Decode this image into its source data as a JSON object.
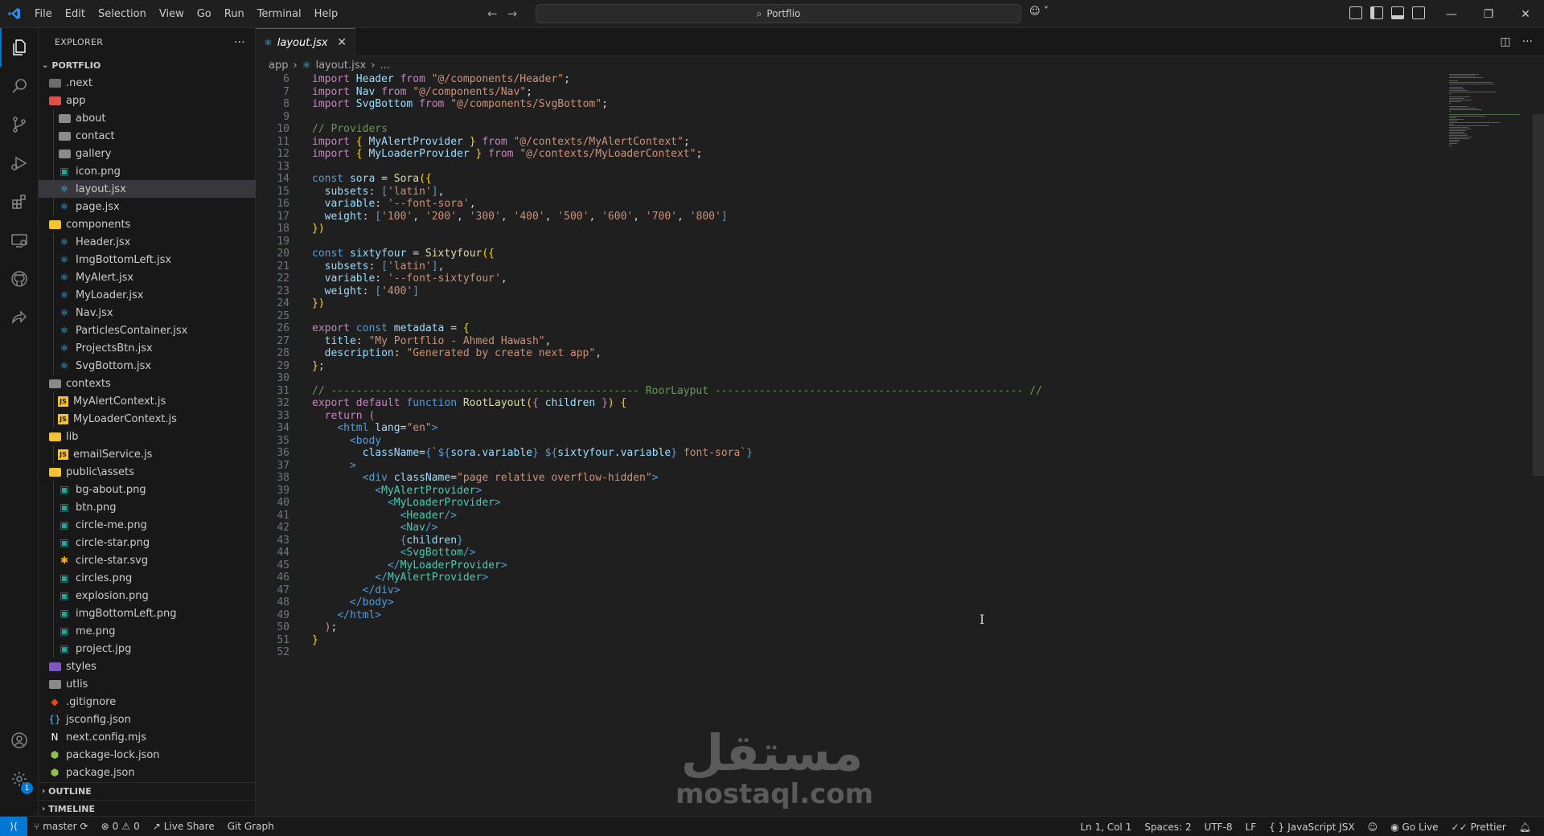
{
  "titlebar": {
    "menu": [
      "File",
      "Edit",
      "Selection",
      "View",
      "Go",
      "Run",
      "Terminal",
      "Help"
    ],
    "search_text": "Portflio"
  },
  "sidebar": {
    "title": "EXPLORER",
    "root": "PORTFLIO",
    "items": [
      {
        "name": ".next",
        "depth": 0,
        "kind": "folder",
        "color": "#6c6c6c"
      },
      {
        "name": "app",
        "depth": 0,
        "kind": "folder",
        "color": "#e04e4e",
        "open": true
      },
      {
        "name": "about",
        "depth": 1,
        "kind": "folder",
        "color": "#8a8a8a"
      },
      {
        "name": "contact",
        "depth": 1,
        "kind": "folder",
        "color": "#8a8a8a"
      },
      {
        "name": "gallery",
        "depth": 1,
        "kind": "folder",
        "color": "#8a8a8a"
      },
      {
        "name": "icon.png",
        "depth": 1,
        "kind": "image",
        "color": "#26a69a"
      },
      {
        "name": "layout.jsx",
        "depth": 1,
        "kind": "react",
        "color": "#4fc3f7",
        "selected": true
      },
      {
        "name": "page.jsx",
        "depth": 1,
        "kind": "react",
        "color": "#4fc3f7"
      },
      {
        "name": "components",
        "depth": 0,
        "kind": "folder",
        "color": "#f4c430",
        "open": true
      },
      {
        "name": "Header.jsx",
        "depth": 1,
        "kind": "react",
        "color": "#4fc3f7"
      },
      {
        "name": "ImgBottomLeft.jsx",
        "depth": 1,
        "kind": "react",
        "color": "#4fc3f7"
      },
      {
        "name": "MyAlert.jsx",
        "depth": 1,
        "kind": "react",
        "color": "#4fc3f7"
      },
      {
        "name": "MyLoader.jsx",
        "depth": 1,
        "kind": "react",
        "color": "#4fc3f7"
      },
      {
        "name": "Nav.jsx",
        "depth": 1,
        "kind": "react",
        "color": "#4fc3f7"
      },
      {
        "name": "ParticlesContainer.jsx",
        "depth": 1,
        "kind": "react",
        "color": "#4fc3f7"
      },
      {
        "name": "ProjectsBtn.jsx",
        "depth": 1,
        "kind": "react",
        "color": "#4fc3f7"
      },
      {
        "name": "SvgBottom.jsx",
        "depth": 1,
        "kind": "react",
        "color": "#4fc3f7"
      },
      {
        "name": "contexts",
        "depth": 0,
        "kind": "folder",
        "color": "#8a8a8a",
        "open": true
      },
      {
        "name": "MyAlertContext.js",
        "depth": 1,
        "kind": "js",
        "color": "#f4c430"
      },
      {
        "name": "MyLoaderContext.js",
        "depth": 1,
        "kind": "js",
        "color": "#f4c430"
      },
      {
        "name": "lib",
        "depth": 0,
        "kind": "folder",
        "color": "#f4c430",
        "open": true
      },
      {
        "name": "emailService.js",
        "depth": 1,
        "kind": "js",
        "color": "#f4c430"
      },
      {
        "name": "public\\assets",
        "depth": 0,
        "kind": "folder",
        "color": "#f4c430",
        "open": true
      },
      {
        "name": "bg-about.png",
        "depth": 1,
        "kind": "image",
        "color": "#26a69a"
      },
      {
        "name": "btn.png",
        "depth": 1,
        "kind": "image",
        "color": "#26a69a"
      },
      {
        "name": "circle-me.png",
        "depth": 1,
        "kind": "image",
        "color": "#26a69a"
      },
      {
        "name": "circle-star.png",
        "depth": 1,
        "kind": "image",
        "color": "#26a69a"
      },
      {
        "name": "circle-star.svg",
        "depth": 1,
        "kind": "svg",
        "color": "#ffb300"
      },
      {
        "name": "circles.png",
        "depth": 1,
        "kind": "image",
        "color": "#26a69a"
      },
      {
        "name": "explosion.png",
        "depth": 1,
        "kind": "image",
        "color": "#26a69a"
      },
      {
        "name": "imgBottomLeft.png",
        "depth": 1,
        "kind": "image",
        "color": "#26a69a"
      },
      {
        "name": "me.png",
        "depth": 1,
        "kind": "image",
        "color": "#26a69a"
      },
      {
        "name": "project.jpg",
        "depth": 1,
        "kind": "image",
        "color": "#26a69a"
      },
      {
        "name": "styles",
        "depth": 0,
        "kind": "folder",
        "color": "#7e57c2"
      },
      {
        "name": "utlis",
        "depth": 0,
        "kind": "folder",
        "color": "#8a8a8a"
      },
      {
        "name": ".gitignore",
        "depth": 0,
        "kind": "git",
        "color": "#e64a19"
      },
      {
        "name": "jsconfig.json",
        "depth": 0,
        "kind": "jsconfig",
        "color": "#4fc3f7"
      },
      {
        "name": "next.config.mjs",
        "depth": 0,
        "kind": "next",
        "color": "#ffffff"
      },
      {
        "name": "package-lock.json",
        "depth": 0,
        "kind": "pkg",
        "color": "#8bc34a"
      },
      {
        "name": "package.json",
        "depth": 0,
        "kind": "pkg",
        "color": "#8bc34a"
      }
    ],
    "outline_label": "OUTLINE",
    "timeline_label": "TIMELINE"
  },
  "editor": {
    "tab_label": "layout.jsx",
    "breadcrumb_folder": "app",
    "breadcrumb_file": "layout.jsx",
    "breadcrumb_more": "...",
    "first_line": 6,
    "lines": [
      [
        [
          "k",
          "import "
        ],
        [
          "v",
          "Header "
        ],
        [
          "k",
          "from "
        ],
        [
          "s",
          "\"@/components/Header\""
        ],
        [
          "p",
          ";"
        ]
      ],
      [
        [
          "k",
          "import "
        ],
        [
          "v",
          "Nav "
        ],
        [
          "k",
          "from "
        ],
        [
          "s",
          "\"@/components/Nav\""
        ],
        [
          "p",
          ";"
        ]
      ],
      [
        [
          "k",
          "import "
        ],
        [
          "v",
          "SvgBottom "
        ],
        [
          "k",
          "from "
        ],
        [
          "s",
          "\"@/components/SvgBottom\""
        ],
        [
          "p",
          ";"
        ]
      ],
      [],
      [
        [
          "c",
          "// Providers"
        ]
      ],
      [
        [
          "k",
          "import "
        ],
        [
          "y",
          "{ "
        ],
        [
          "v",
          "MyAlertProvider "
        ],
        [
          "y",
          "} "
        ],
        [
          "k",
          "from "
        ],
        [
          "s",
          "\"@/contexts/MyAlertContext\""
        ],
        [
          "p",
          ";"
        ]
      ],
      [
        [
          "k",
          "import "
        ],
        [
          "y",
          "{ "
        ],
        [
          "v",
          "MyLoaderProvider "
        ],
        [
          "y",
          "} "
        ],
        [
          "k",
          "from "
        ],
        [
          "s",
          "\"@/contexts/MyLoaderContext\""
        ],
        [
          "p",
          ";"
        ]
      ],
      [],
      [
        [
          "kb",
          "const "
        ],
        [
          "v",
          "sora "
        ],
        [
          "p",
          "= "
        ],
        [
          "f",
          "Sora"
        ],
        [
          "y",
          "({"
        ]
      ],
      [
        [
          "p",
          "  "
        ],
        [
          "v",
          "subsets"
        ],
        [
          "p",
          ": "
        ],
        [
          "kb",
          "["
        ],
        [
          "s",
          "'latin'"
        ],
        [
          "kb",
          "]"
        ],
        [
          "p",
          ","
        ]
      ],
      [
        [
          "p",
          "  "
        ],
        [
          "v",
          "variable"
        ],
        [
          "p",
          ": "
        ],
        [
          "s",
          "'--font-sora'"
        ],
        [
          "p",
          ","
        ]
      ],
      [
        [
          "p",
          "  "
        ],
        [
          "v",
          "weight"
        ],
        [
          "p",
          ": "
        ],
        [
          "kb",
          "["
        ],
        [
          "s",
          "'100'"
        ],
        [
          "p",
          ", "
        ],
        [
          "s",
          "'200'"
        ],
        [
          "p",
          ", "
        ],
        [
          "s",
          "'300'"
        ],
        [
          "p",
          ", "
        ],
        [
          "s",
          "'400'"
        ],
        [
          "p",
          ", "
        ],
        [
          "s",
          "'500'"
        ],
        [
          "p",
          ", "
        ],
        [
          "s",
          "'600'"
        ],
        [
          "p",
          ", "
        ],
        [
          "s",
          "'700'"
        ],
        [
          "p",
          ", "
        ],
        [
          "s",
          "'800'"
        ],
        [
          "kb",
          "]"
        ]
      ],
      [
        [
          "y",
          "})"
        ]
      ],
      [],
      [
        [
          "kb",
          "const "
        ],
        [
          "v",
          "sixtyfour "
        ],
        [
          "p",
          "= "
        ],
        [
          "f",
          "Sixtyfour"
        ],
        [
          "y",
          "({"
        ]
      ],
      [
        [
          "p",
          "  "
        ],
        [
          "v",
          "subsets"
        ],
        [
          "p",
          ": "
        ],
        [
          "kb",
          "["
        ],
        [
          "s",
          "'latin'"
        ],
        [
          "kb",
          "]"
        ],
        [
          "p",
          ","
        ]
      ],
      [
        [
          "p",
          "  "
        ],
        [
          "v",
          "variable"
        ],
        [
          "p",
          ": "
        ],
        [
          "s",
          "'--font-sixtyfour'"
        ],
        [
          "p",
          ","
        ]
      ],
      [
        [
          "p",
          "  "
        ],
        [
          "v",
          "weight"
        ],
        [
          "p",
          ": "
        ],
        [
          "kb",
          "["
        ],
        [
          "s",
          "'400'"
        ],
        [
          "kb",
          "]"
        ]
      ],
      [
        [
          "y",
          "})"
        ]
      ],
      [],
      [
        [
          "k",
          "export "
        ],
        [
          "kb",
          "const "
        ],
        [
          "v",
          "metadata "
        ],
        [
          "p",
          "= "
        ],
        [
          "y",
          "{"
        ]
      ],
      [
        [
          "p",
          "  "
        ],
        [
          "v",
          "title"
        ],
        [
          "p",
          ": "
        ],
        [
          "s",
          "\"My Portflio - Ahmed Hawash\""
        ],
        [
          "p",
          ","
        ]
      ],
      [
        [
          "p",
          "  "
        ],
        [
          "v",
          "description"
        ],
        [
          "p",
          ": "
        ],
        [
          "s",
          "\"Generated by create next app\""
        ],
        [
          "p",
          ","
        ]
      ],
      [
        [
          "y",
          "}"
        ],
        [
          "p",
          ";"
        ]
      ],
      [],
      [
        [
          "c",
          "// ------------------------------------------------- RoorLayput ------------------------------------------------- //"
        ]
      ],
      [
        [
          "k",
          "export default "
        ],
        [
          "kb",
          "function "
        ],
        [
          "f",
          "RootLayout"
        ],
        [
          "y",
          "("
        ],
        [
          "k",
          "{ "
        ],
        [
          "v",
          "children "
        ],
        [
          "k",
          "}"
        ],
        [
          "y",
          ") {"
        ]
      ],
      [
        [
          "p",
          "  "
        ],
        [
          "k",
          "return "
        ],
        [
          "k",
          "("
        ]
      ],
      [
        [
          "p",
          "    "
        ],
        [
          "t",
          "<"
        ],
        [
          "t",
          "html "
        ],
        [
          "v",
          "lang"
        ],
        [
          "p",
          "="
        ],
        [
          "s",
          "\"en\""
        ],
        [
          "t",
          ">"
        ]
      ],
      [
        [
          "p",
          "      "
        ],
        [
          "t",
          "<"
        ],
        [
          "t",
          "body"
        ]
      ],
      [
        [
          "p",
          "        "
        ],
        [
          "v",
          "className"
        ],
        [
          "p",
          "="
        ],
        [
          "kb",
          "{"
        ],
        [
          "s",
          "`"
        ],
        [
          "kb",
          "${"
        ],
        [
          "v",
          "sora"
        ],
        [
          "p",
          "."
        ],
        [
          "v",
          "variable"
        ],
        [
          "kb",
          "}"
        ],
        [
          "s",
          " "
        ],
        [
          "kb",
          "${"
        ],
        [
          "v",
          "sixtyfour"
        ],
        [
          "p",
          "."
        ],
        [
          "v",
          "variable"
        ],
        [
          "kb",
          "}"
        ],
        [
          "s",
          " font-sora`"
        ],
        [
          "kb",
          "}"
        ]
      ],
      [
        [
          "p",
          "      "
        ],
        [
          "t",
          ">"
        ]
      ],
      [
        [
          "p",
          "        "
        ],
        [
          "t",
          "<"
        ],
        [
          "t",
          "div "
        ],
        [
          "v",
          "className"
        ],
        [
          "p",
          "="
        ],
        [
          "s",
          "\"page relative overflow-hidden\""
        ],
        [
          "t",
          ">"
        ]
      ],
      [
        [
          "p",
          "          "
        ],
        [
          "t",
          "<"
        ],
        [
          "tg",
          "MyAlertProvider"
        ],
        [
          "t",
          ">"
        ]
      ],
      [
        [
          "p",
          "            "
        ],
        [
          "t",
          "<"
        ],
        [
          "tg",
          "MyLoaderProvider"
        ],
        [
          "t",
          ">"
        ]
      ],
      [
        [
          "p",
          "              "
        ],
        [
          "t",
          "<"
        ],
        [
          "tg",
          "Header"
        ],
        [
          "t",
          "/>"
        ]
      ],
      [
        [
          "p",
          "              "
        ],
        [
          "t",
          "<"
        ],
        [
          "tg",
          "Nav"
        ],
        [
          "t",
          "/>"
        ]
      ],
      [
        [
          "p",
          "              "
        ],
        [
          "kb",
          "{"
        ],
        [
          "v",
          "children"
        ],
        [
          "kb",
          "}"
        ]
      ],
      [
        [
          "p",
          "              "
        ],
        [
          "t",
          "<"
        ],
        [
          "tg",
          "SvgBottom"
        ],
        [
          "t",
          "/>"
        ]
      ],
      [
        [
          "p",
          "            "
        ],
        [
          "t",
          "</"
        ],
        [
          "tg",
          "MyLoaderProvider"
        ],
        [
          "t",
          ">"
        ]
      ],
      [
        [
          "p",
          "          "
        ],
        [
          "t",
          "</"
        ],
        [
          "tg",
          "MyAlertProvider"
        ],
        [
          "t",
          ">"
        ]
      ],
      [
        [
          "p",
          "        "
        ],
        [
          "t",
          "</"
        ],
        [
          "t",
          "div"
        ],
        [
          "t",
          ">"
        ]
      ],
      [
        [
          "p",
          "      "
        ],
        [
          "t",
          "</"
        ],
        [
          "t",
          "body"
        ],
        [
          "t",
          ">"
        ]
      ],
      [
        [
          "p",
          "    "
        ],
        [
          "t",
          "</"
        ],
        [
          "t",
          "html"
        ],
        [
          "t",
          ">"
        ]
      ],
      [
        [
          "p",
          "  "
        ],
        [
          "k",
          ")"
        ],
        [
          "p",
          ";"
        ]
      ],
      [
        [
          "y",
          "}"
        ]
      ],
      []
    ]
  },
  "statusbar": {
    "branch": "master",
    "errors": "0",
    "warnings": "0",
    "live_share": "Live Share",
    "git_graph": "Git Graph",
    "position": "Ln 1, Col 1",
    "spaces": "Spaces: 2",
    "encoding": "UTF-8",
    "eol": "LF",
    "language": "JavaScript JSX",
    "go_live": "Go Live",
    "prettier": "Prettier",
    "notification_count": "1"
  },
  "watermark": {
    "arabic": "مستقل",
    "latin": "mostaql.com"
  }
}
